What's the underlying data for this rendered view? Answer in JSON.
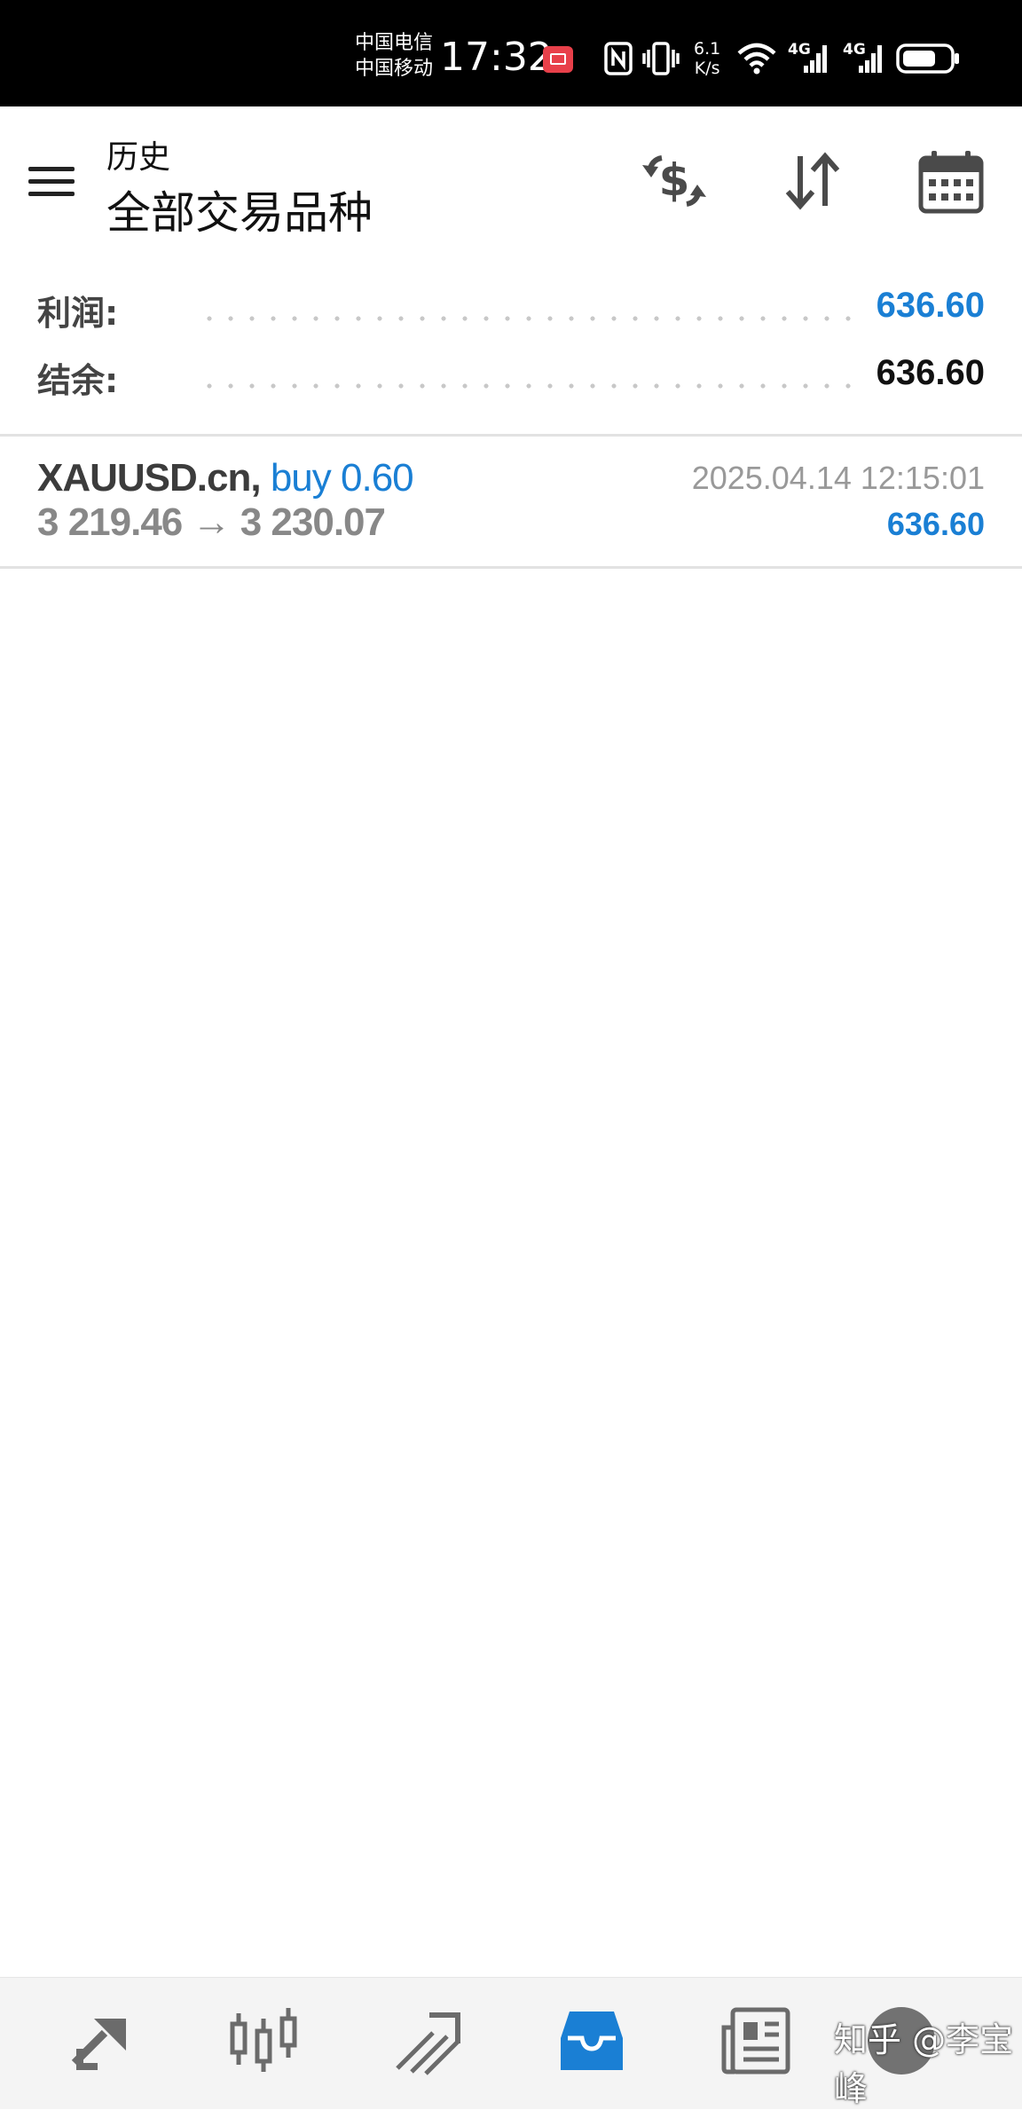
{
  "status_bar": {
    "carrier1": "中国电信",
    "carrier2": "中国移动",
    "time": "17:32",
    "net_speed_value": "6.1",
    "net_speed_unit": "K/s",
    "signal1_label": "4G",
    "signal2_label": "4G"
  },
  "header": {
    "section": "历史",
    "title": "全部交易品种",
    "icons": [
      "currency-exchange-icon",
      "sort-icon",
      "calendar-icon"
    ]
  },
  "summary": {
    "profit_label": "利润:",
    "profit_value": "636.60",
    "balance_label": "结余:",
    "balance_value": "636.60"
  },
  "deals": [
    {
      "symbol": "XAUUSD.cn,",
      "side": "buy 0.60",
      "prices": "3 219.46 → 3 230.07",
      "time": "2025.04.14 12:15:01",
      "profit": "636.60"
    }
  ],
  "colors": {
    "accent": "#1a7fd4",
    "text_dark": "#3c3c3c",
    "text_muted": "#888888"
  },
  "bottom_nav": {
    "items": [
      "quotes-icon",
      "chart-icon",
      "trade-icon",
      "history-icon",
      "news-icon",
      "messages-icon"
    ],
    "active_index": 3
  },
  "watermark": "知乎 @李宝峰"
}
